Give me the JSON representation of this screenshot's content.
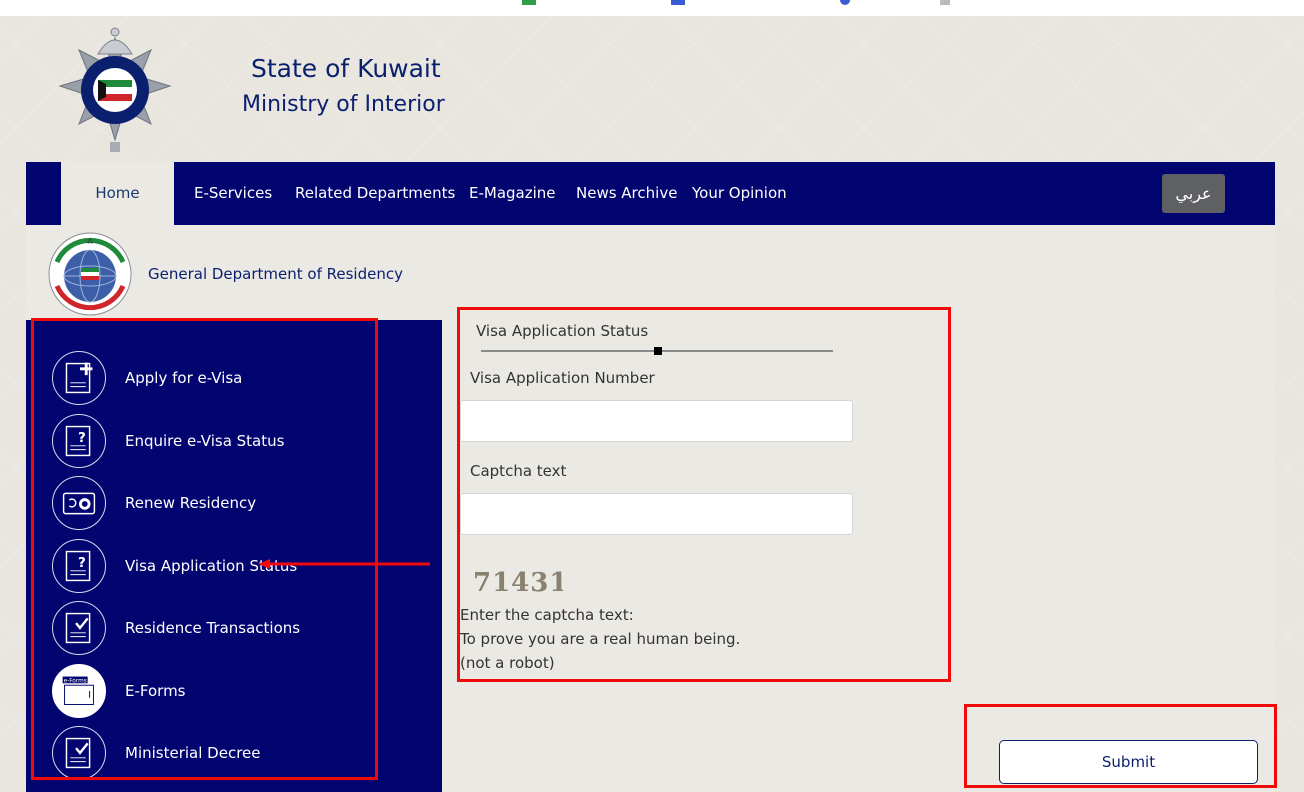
{
  "header": {
    "title_line1": "State of Kuwait",
    "title_line2": "Ministry of Interior",
    "logo_icon": "kuwait-police-emblem-icon"
  },
  "nav": {
    "items": [
      {
        "label": "Home",
        "active": true
      },
      {
        "label": "E-Services"
      },
      {
        "label": "Related Departments"
      },
      {
        "label": "E-Magazine"
      },
      {
        "label": "News Archive"
      },
      {
        "label": "Your Opinion"
      }
    ],
    "language_button": "عربي"
  },
  "department": {
    "title": "General Department of Residency",
    "logo_icon": "residency-department-emblem-icon"
  },
  "sidebar": {
    "items": [
      {
        "label": "Apply for e-Visa",
        "icon": "document-plus-icon"
      },
      {
        "label": "Enquire e-Visa Status",
        "icon": "document-question-icon"
      },
      {
        "label": "Renew Residency",
        "icon": "card-renew-icon"
      },
      {
        "label": "Visa Application Status",
        "icon": "document-question-icon"
      },
      {
        "label": "Residence Transactions",
        "icon": "document-check-icon"
      },
      {
        "label": "E-Forms",
        "icon": "eforms-icon",
        "icon_text": "e-Forms"
      },
      {
        "label": "Ministerial Decree",
        "icon": "document-check-icon"
      }
    ]
  },
  "form": {
    "section_title": "Visa Application Status",
    "app_number_label": "Visa Application Number",
    "app_number_value": "",
    "captcha_label": "Captcha text",
    "captcha_value": "",
    "captcha_image_text": "71431",
    "note_line1": "Enter the captcha text:",
    "note_line2": "To prove you are a real human being.",
    "note_line3": "(not a robot)",
    "submit_label": "Submit"
  },
  "colors": {
    "nav_bg": "#020570",
    "page_bg": "#e8e6df",
    "accent_text": "#0a1f6e",
    "highlight_red": "#f10a0a"
  }
}
